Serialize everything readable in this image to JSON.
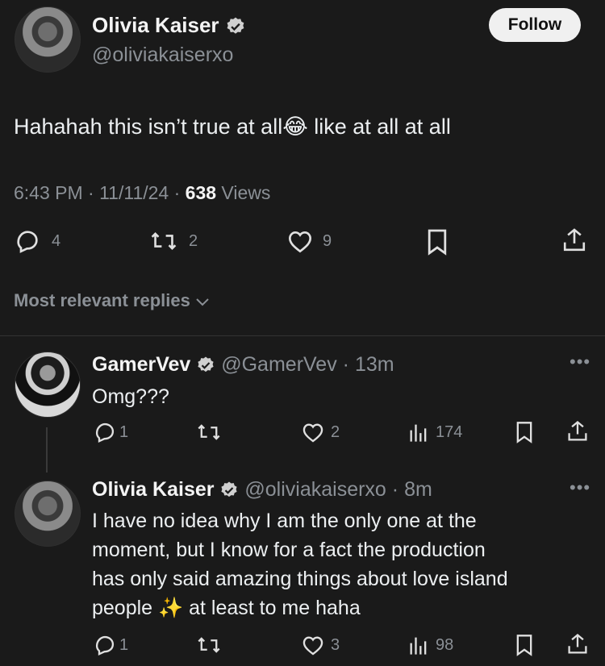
{
  "main_tweet": {
    "author_name": "Olivia Kaiser",
    "author_handle": "@oliviakaiserxo",
    "follow_label": "Follow",
    "text": "Hahahah this isn’t true at all😂 like at all at all",
    "time": "6:43 PM · 11/11/24 · ",
    "views_count": "638",
    "views_label": " Views",
    "reply_count": "4",
    "retweet_count": "2",
    "like_count": "9"
  },
  "sort": {
    "label": "Most relevant replies"
  },
  "replies": [
    {
      "author_name": "GamerVev",
      "author_handle": "@GamerVev",
      "time": "· 13m",
      "text": "Omg???",
      "reply_count": "1",
      "retweet_count": "",
      "like_count": "2",
      "view_count": "174"
    },
    {
      "author_name": "Olivia Kaiser",
      "author_handle": "@oliviakaiserxo",
      "time": "· 8m",
      "text_lines": [
        "I have no idea why I am the only one at the",
        "moment, but I know for a fact the production",
        "has only said amazing things about love island",
        "people ✨ at least to me haha"
      ],
      "reply_count": "1",
      "retweet_count": "",
      "like_count": "3",
      "view_count": "98"
    }
  ],
  "colors": {
    "background": "#1a1a1a",
    "muted": "#8b9096",
    "text": "#eceff1"
  },
  "icons": [
    "verified-icon",
    "reply-icon",
    "retweet-icon",
    "like-icon",
    "bookmark-icon",
    "share-icon",
    "views-icon",
    "more-icon",
    "chevron-down-icon"
  ]
}
